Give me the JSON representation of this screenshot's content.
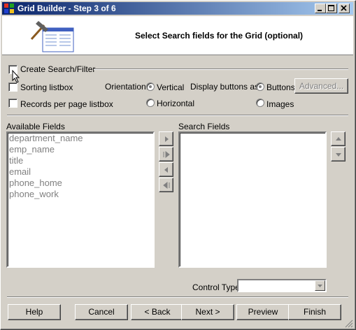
{
  "window": {
    "title": "Grid Builder - Step 3 of 6"
  },
  "header": {
    "subtitle": "Select Search fields for the Grid (optional)"
  },
  "options": {
    "create_search": "Create Search/Filter",
    "sorting_listbox": "Sorting listbox",
    "records_per_page": "Records per page listbox",
    "orientation_label": "Orientation:",
    "orientation_vertical": "Vertical",
    "orientation_horizontal": "Horizontal",
    "display_buttons_label": "Display buttons as:",
    "display_buttons": "Buttons",
    "display_images": "Images",
    "advanced_label": "Advanced..."
  },
  "available_fields": {
    "label": "Available Fields",
    "items": [
      "department_name",
      "emp_name",
      "title",
      "email",
      "phone_home",
      "phone_work"
    ]
  },
  "search_fields": {
    "label": "Search Fields",
    "items": []
  },
  "control_type": {
    "label": "Control Type",
    "value": ""
  },
  "footer": {
    "help": "Help",
    "cancel": "Cancel",
    "back": "< Back",
    "next": "Next >",
    "preview": "Preview",
    "finish": "Finish"
  },
  "colors": {
    "title_start": "#0a246a",
    "title_end": "#a6caf0",
    "face": "#d4d0c8"
  }
}
